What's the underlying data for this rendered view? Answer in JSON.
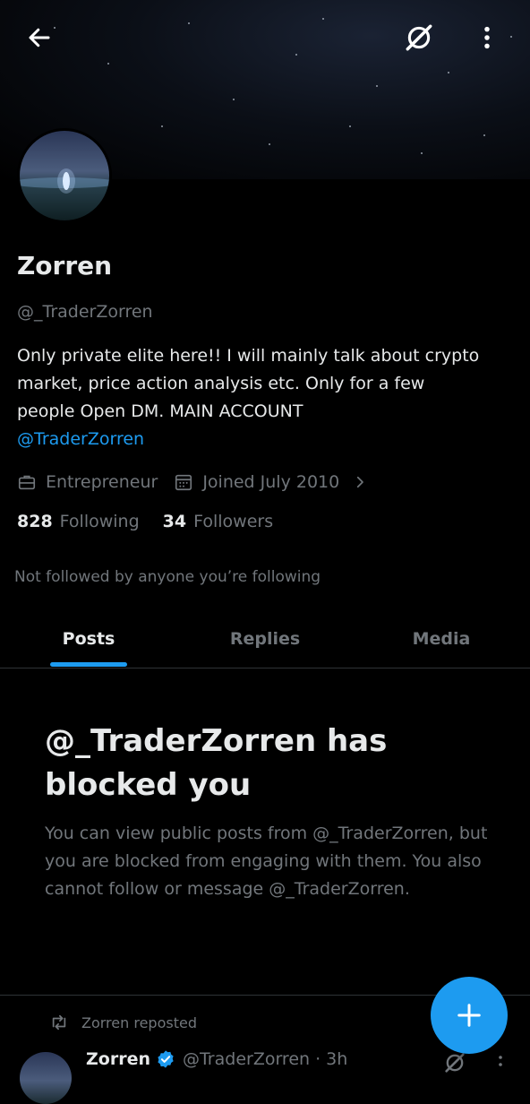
{
  "profile": {
    "display_name": "Zorren",
    "handle": "@_TraderZorren",
    "bio_text": "Only private elite here!! I will mainly talk about crypto market, price action analysis etc. Only for a few people Open DM. MAIN ACCOUNT",
    "bio_mention": "@TraderZorren",
    "profession": "Entrepreneur",
    "joined": "Joined July 2010",
    "following_count": "828",
    "following_label": "Following",
    "followers_count": "34",
    "followers_label": "Followers",
    "not_followed_text": "Not followed by anyone you’re following"
  },
  "tabs": [
    {
      "label": "Posts",
      "active": true
    },
    {
      "label": "Replies",
      "active": false
    },
    {
      "label": "Media",
      "active": false
    }
  ],
  "blocked": {
    "title": "@_TraderZorren has blocked you",
    "description": "You can view public posts from @_TraderZorren, but you are blocked from engaging with them. You also cannot follow or message @_TraderZorren."
  },
  "post": {
    "repost_text": "Zorren reposted",
    "author_name": "Zorren",
    "author_handle_time": "@TraderZorren · 3h"
  },
  "colors": {
    "accent": "#1d9bf0",
    "background": "#000000",
    "text_primary": "#e7e9ea",
    "text_secondary": "#71767b"
  },
  "icons": {
    "back": "arrow-left-icon",
    "grok": "grok-icon",
    "more": "more-vertical-icon",
    "profession": "briefcase-icon",
    "joined": "calendar-icon",
    "chevron": "chevron-right-icon",
    "repost": "repost-icon",
    "verified": "verified-badge-icon",
    "compose": "plus-icon"
  }
}
